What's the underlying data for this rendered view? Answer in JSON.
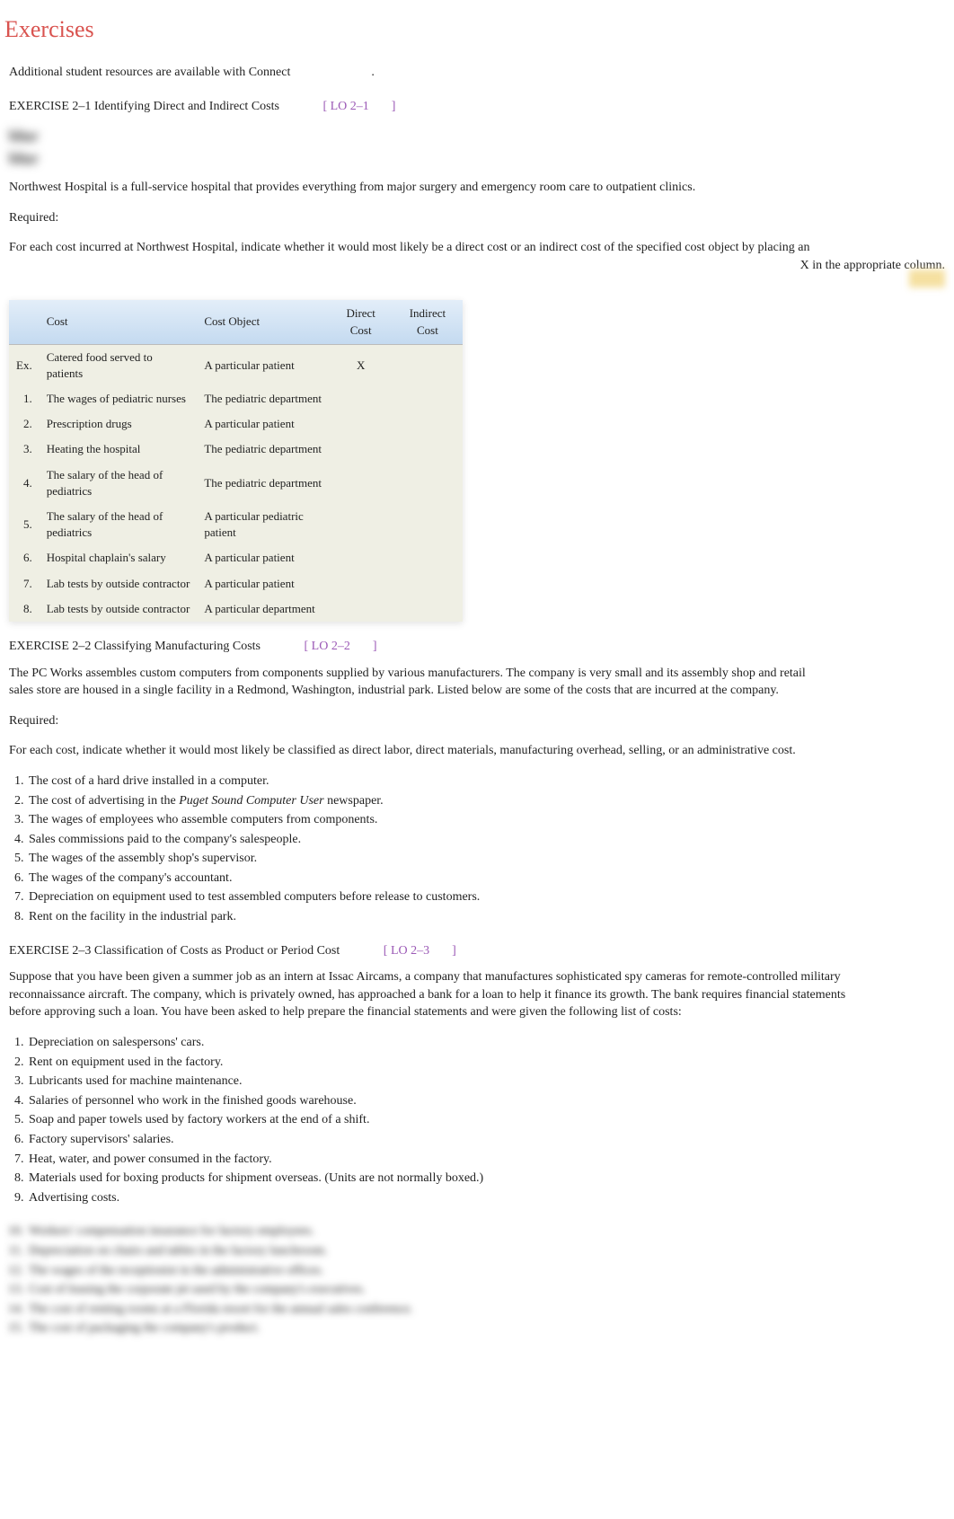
{
  "heading": "Exercises",
  "intro": "Additional student resources are available with Connect",
  "introPeriod": ".",
  "ex1": {
    "title": "EXERCISE 2–1 Identifying Direct and Indirect Costs",
    "lo": "LO 2–1",
    "blurredTag": "blur",
    "description": "Northwest Hospital is a full-service hospital that provides everything from major surgery and emergency room care to outpatient clinics.",
    "requiredLabel": "Required:",
    "requiredText1": "For each cost incurred at Northwest Hospital, indicate whether it would most likely be a direct cost or an indirect cost of the specified cost object by placing an",
    "requiredText2": "X in the appropriate column.",
    "table": {
      "headers": {
        "cost": "Cost",
        "costObject": "Cost Object",
        "direct": "Direct Cost",
        "indirect": "Indirect Cost"
      },
      "rows": [
        {
          "n": "Ex.",
          "cost": "Catered food served to patients",
          "obj": "A particular patient",
          "d": "X",
          "i": ""
        },
        {
          "n": "1.",
          "cost": "The wages of pediatric nurses",
          "obj": "The pediatric department",
          "d": "",
          "i": ""
        },
        {
          "n": "2.",
          "cost": "Prescription drugs",
          "obj": "A particular patient",
          "d": "",
          "i": ""
        },
        {
          "n": "3.",
          "cost": "Heating the hospital",
          "obj": "The pediatric department",
          "d": "",
          "i": ""
        },
        {
          "n": "4.",
          "cost": "The salary of the head of pediatrics",
          "obj": "The pediatric department",
          "d": "",
          "i": ""
        },
        {
          "n": "5.",
          "cost": "The salary of the head of pediatrics",
          "obj": "A particular pediatric patient",
          "d": "",
          "i": ""
        },
        {
          "n": "6.",
          "cost": "Hospital chaplain's salary",
          "obj": "A particular patient",
          "d": "",
          "i": ""
        },
        {
          "n": "7.",
          "cost": "Lab tests by outside contractor",
          "obj": "A particular patient",
          "d": "",
          "i": ""
        },
        {
          "n": "8.",
          "cost": "Lab tests by outside contractor",
          "obj": "A particular department",
          "d": "",
          "i": ""
        }
      ]
    }
  },
  "ex2": {
    "title": "EXERCISE 2–2 Classifying Manufacturing Costs",
    "lo": "LO 2–2",
    "description": "The PC Works assembles custom computers from components supplied by various manufacturers. The company is very small and its assembly shop and retail sales store are housed in a single facility in a Redmond, Washington, industrial park. Listed below are some of the costs that are incurred at the company.",
    "requiredLabel": "Required:",
    "requiredText": "For each cost, indicate whether it would most likely be classified as direct labor, direct materials, manufacturing overhead, selling, or an administrative cost.",
    "items": [
      "The cost of a hard drive installed in a computer.",
      "The cost of advertising in the  Puget Sound Computer User  newspaper.",
      "The wages of employees who assemble computers from components.",
      "Sales commissions paid to the company's salespeople.",
      "The wages of the assembly shop's supervisor.",
      "The wages of the company's accountant.",
      "Depreciation on equipment used to test assembled computers before release to customers.",
      "Rent on the facility in the industrial park."
    ]
  },
  "ex3": {
    "title": "EXERCISE 2–3 Classification of Costs as Product or Period Cost",
    "lo": "LO 2–3",
    "description": "Suppose that you have been given a summer job as an intern at Issac Aircams, a company that manufactures sophisticated spy cameras for remote-controlled military reconnaissance aircraft. The company, which is privately owned, has approached a bank for a loan to help it finance its growth. The bank requires financial statements before approving such a loan. You have been asked to help prepare the financial statements and were given the following list of costs:",
    "items": [
      "Depreciation on salespersons' cars.",
      "Rent on equipment used in the factory.",
      "Lubricants used for machine maintenance.",
      "Salaries of personnel who work in the finished goods warehouse.",
      "Soap and paper towels used by factory workers at the end of a shift.",
      "Factory supervisors' salaries.",
      "Heat, water, and power consumed in the factory.",
      "Materials used for boxing products for shipment overseas. (Units are not normally boxed.)",
      "Advertising costs."
    ],
    "blurredItems": [
      "Workers' compensation insurance for factory employees.",
      "Depreciation on chairs and tables in the factory lunchroom.",
      "The wages of the receptionist in the administrative offices.",
      "Cost of leasing the corporate jet used by the company's executives.",
      "The cost of renting rooms at a Florida resort for the annual sales conference.",
      "The cost of packaging the company's product."
    ]
  }
}
